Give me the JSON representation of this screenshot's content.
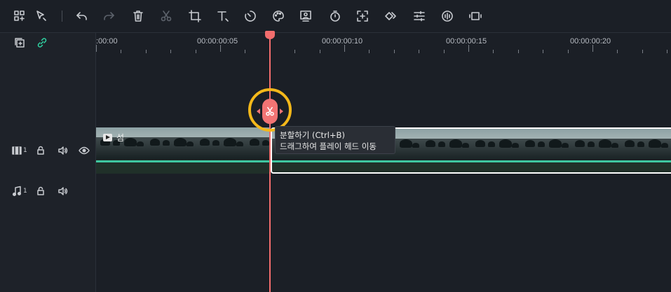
{
  "toolbar": {
    "items": [
      "select-layout",
      "pointer",
      "undo",
      "redo",
      "delete",
      "cut",
      "crop",
      "text",
      "speed",
      "color",
      "ai-portrait",
      "timer",
      "freeze-frame",
      "keyframe",
      "adjust",
      "audio",
      "motion-tracking"
    ]
  },
  "left_panel": {
    "video_track_number": "1",
    "audio_track_number": "1"
  },
  "ruler": {
    "labels": [
      ":00:00",
      "00:00:00:05",
      "00:00:00:10",
      "00:00:00:15",
      "00:00:00:20"
    ]
  },
  "clip": {
    "title": "섬"
  },
  "tooltip": {
    "line1": "분할하기 (Ctrl+B)",
    "line2": "드래그하여 플레이 헤드 이동"
  },
  "colors": {
    "playhead": "#f26d6d",
    "highlight_ring": "#f4b81a",
    "accent_green": "#2fd4a3",
    "audio_strip": "#3fc7a0"
  }
}
